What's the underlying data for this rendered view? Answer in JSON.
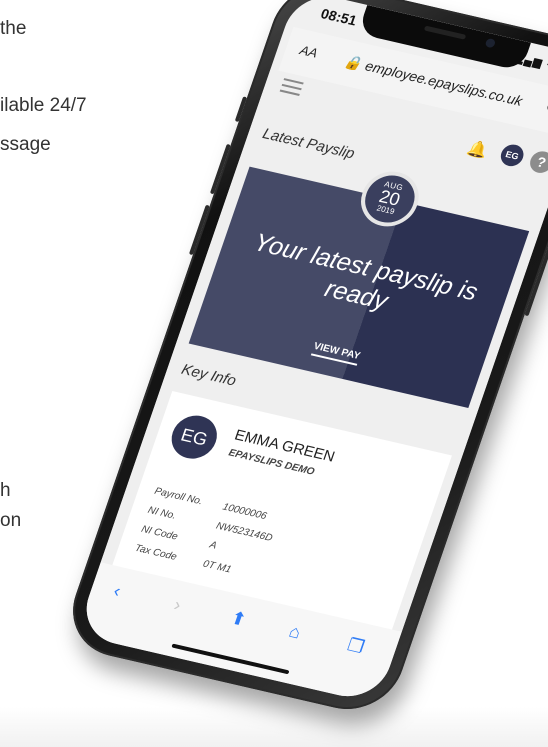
{
  "background_text": {
    "line1": "the",
    "line2": "ilable 24/7",
    "line3": "ssage",
    "line4": "h",
    "line5": "on"
  },
  "status_bar": {
    "time": "08:51",
    "icons": "▂▄▆ ◠ ▭"
  },
  "browser": {
    "text_size_label": "AA",
    "url": "employee.epayslips.co.uk",
    "reload_icon": "reload-icon"
  },
  "app_header": {
    "avatar_initials": "EG",
    "help_label": "?"
  },
  "latest_payslip": {
    "section_title": "Latest Payslip",
    "month": "AUG",
    "day": "20",
    "year": "2019",
    "message": "Your latest payslip is ready",
    "view_label": "VIEW PAY"
  },
  "key_info": {
    "section_title": "Key Info",
    "initials": "EG",
    "name": "EMMA GREEN",
    "company": "EPAYSLIPS DEMO",
    "fields": [
      {
        "label": "Payroll No.",
        "value": "10000006"
      },
      {
        "label": "NI No.",
        "value": "NW523146D"
      },
      {
        "label": "NI Code",
        "value": "A"
      },
      {
        "label": "Tax Code",
        "value": "0T M1"
      }
    ]
  },
  "toolbar": {
    "back": "‹",
    "forward": "›",
    "share": "⬆",
    "bookmarks": "⌂",
    "tabs": "❐"
  },
  "colors": {
    "accent": "#2f3455",
    "card_left": "#454a67",
    "card_right": "#2c3152",
    "safari_blue": "#2f7cf6"
  }
}
